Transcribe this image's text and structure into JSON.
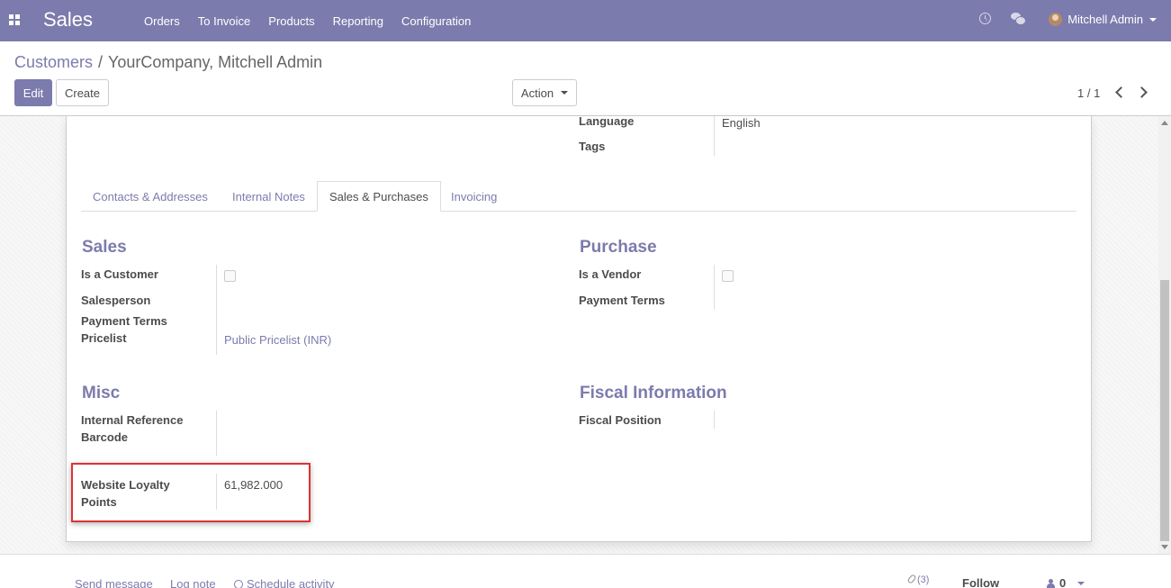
{
  "navbar": {
    "brand": "Sales",
    "menu": [
      "Orders",
      "To Invoice",
      "Products",
      "Reporting",
      "Configuration"
    ],
    "user_name": "Mitchell Admin",
    "icons": [
      "apps-icon",
      "clock-icon",
      "chat-icon",
      "avatar",
      "chevron-down-icon"
    ],
    "color": "#7c7bad"
  },
  "breadcrumb": {
    "parent": "Customers",
    "separator": "/",
    "current": "YourCompany, Mitchell Admin"
  },
  "buttons": {
    "edit": "Edit",
    "create": "Create",
    "action": "Action"
  },
  "pager": {
    "value": "1 / 1"
  },
  "form": {
    "top_fields": {
      "language_label": "Language",
      "language_value": "English",
      "tags_label": "Tags"
    },
    "tabs": [
      "Contacts & Addresses",
      "Internal Notes",
      "Sales & Purchases",
      "Invoicing"
    ],
    "active_tab": "Sales & Purchases",
    "sales": {
      "title": "Sales",
      "is_customer_label": "Is a Customer",
      "is_customer": false,
      "salesperson_label": "Salesperson",
      "payment_terms_label": "Payment Terms",
      "pricelist_label": "Pricelist",
      "pricelist_value": "Public Pricelist (INR)"
    },
    "purchase": {
      "title": "Purchase",
      "is_vendor_label": "Is a Vendor",
      "is_vendor": false,
      "payment_terms_label": "Payment Terms"
    },
    "misc": {
      "title": "Misc",
      "internal_reference_label": "Internal Reference",
      "barcode_label": "Barcode",
      "loyalty_label_line1": "Website Loyalty",
      "loyalty_label_line2": "Points",
      "loyalty_value": "61,982.000"
    },
    "fiscal": {
      "title": "Fiscal Information",
      "fiscal_position_label": "Fiscal Position"
    }
  },
  "chatter": {
    "send_message": "Send message",
    "log_note": "Log note",
    "schedule_activity": "Schedule activity",
    "attachments": "(3)",
    "follow": "Follow",
    "followers": "0"
  },
  "highlight_color": "#dd3333"
}
